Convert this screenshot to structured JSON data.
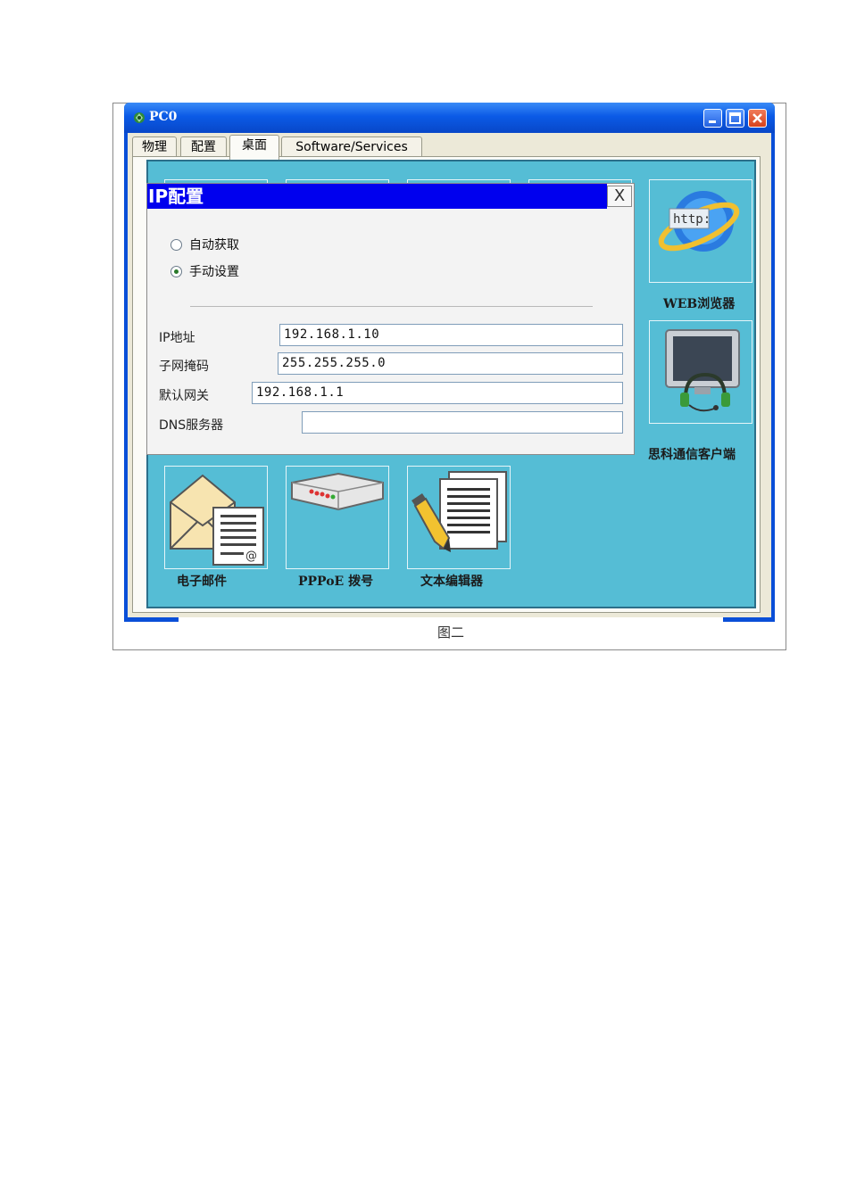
{
  "window": {
    "title": "PC0",
    "colors": {
      "titlebar": "#0b5ae6",
      "desktop": "#55bdd5",
      "dialog_title": "#0000ee"
    }
  },
  "tabs": [
    {
      "label": "物理"
    },
    {
      "label": "配置"
    },
    {
      "label": "桌面",
      "active": true
    },
    {
      "label": "Software/Services"
    }
  ],
  "apps": {
    "web_browser": {
      "label": "WEB浏览器",
      "icon": "ie-http-icon"
    },
    "cisco_client": {
      "label": "思科通信客户端",
      "icon": "monitor-headset-icon"
    },
    "email": {
      "label": "电子邮件",
      "icon": "envelope-icon"
    },
    "pppoe": {
      "label": "PPPoE 拨号",
      "icon": "modem-icon"
    },
    "text_editor": {
      "label": "文本编辑器",
      "icon": "document-pencil-icon"
    }
  },
  "ip_config": {
    "title": "IP配置",
    "close_label": "X",
    "mode": {
      "auto_label": "自动获取",
      "manual_label": "手动设置",
      "selected": "manual"
    },
    "fields": {
      "ip": {
        "label": "IP地址",
        "value": "192.168.1.10"
      },
      "mask": {
        "label": "子网掩码",
        "value": "255.255.255.0"
      },
      "gateway": {
        "label": "默认网关",
        "value": "192.168.1.1"
      },
      "dns": {
        "label": "DNS服务器",
        "value": ""
      }
    }
  },
  "caption": "图二"
}
